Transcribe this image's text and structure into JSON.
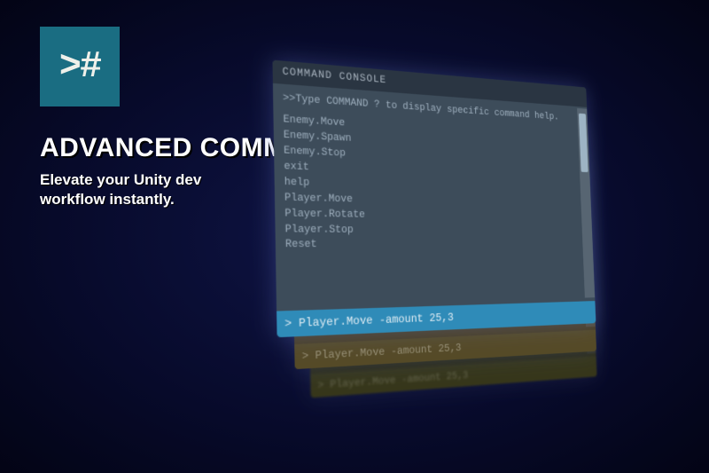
{
  "logo": {
    "symbol": ">#"
  },
  "hero": {
    "title": "ADVANCED COMMAND CONSOLE",
    "subtitle": "Elevate your Unity dev workflow instantly."
  },
  "console": {
    "header": "COMMAND CONSOLE",
    "hint": ">>Type COMMAND ? to display specific command help.",
    "commands": [
      "Enemy.Move",
      "Enemy.Spawn",
      "Enemy.Stop",
      "exit",
      "help",
      "Player.Move",
      "Player.Rotate",
      "Player.Stop",
      "Reset"
    ],
    "input_prefix": ">",
    "input_value": "Player.Move -amount 25,3"
  }
}
